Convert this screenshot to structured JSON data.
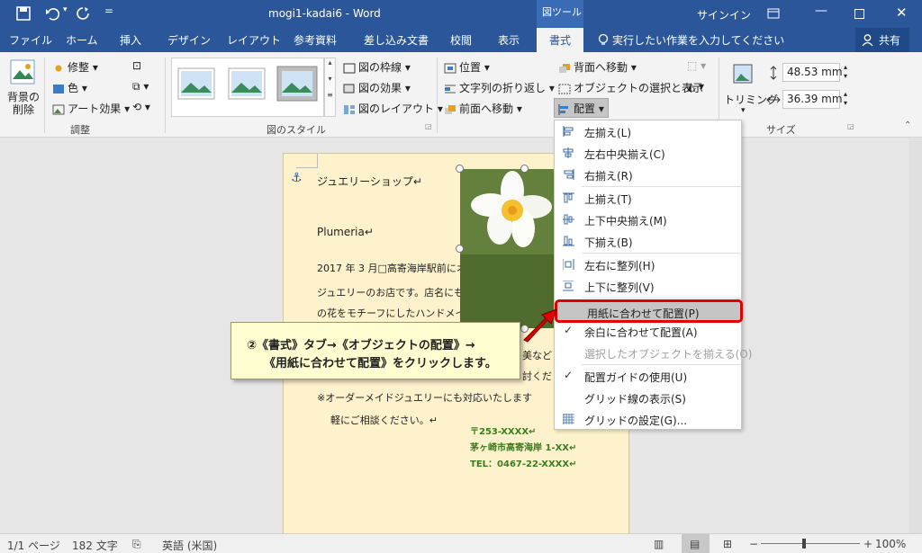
{
  "titlebar": {
    "doc_title": "mogi1-kadai6 - Word",
    "context_group": "図ツール",
    "signin": "サインイン"
  },
  "tabs": [
    "ファイル",
    "ホーム",
    "挿入",
    "デザイン",
    "レイアウト",
    "参考資料",
    "差し込み文書",
    "校閲",
    "表示",
    "書式"
  ],
  "tell_me": "実行したい作業を入力してください",
  "share": "共有",
  "ribbon": {
    "remove_bg": [
      "背景の",
      "削除"
    ],
    "adjust": {
      "corrections": "修整",
      "color": "色",
      "artistic": "アート効果",
      "label": "調整"
    },
    "styles": {
      "border": "図の枠線",
      "effects": "図の効果",
      "layout": "図のレイアウト",
      "label": "図のスタイル"
    },
    "arrange": {
      "position": "位置",
      "wrap": "文字列の折り返し",
      "forward": "前面へ移動",
      "backward": "背面へ移動",
      "selection": "オブジェクトの選択と表示",
      "align": "配置"
    },
    "size": {
      "crop": "トリミング",
      "height": "48.53 mm",
      "width": "36.39 mm",
      "label": "サイズ"
    }
  },
  "menu": {
    "items": [
      {
        "label": "左揃え(L)",
        "enabled": true,
        "checked": false
      },
      {
        "label": "左右中央揃え(C)",
        "enabled": true,
        "checked": false
      },
      {
        "label": "右揃え(R)",
        "enabled": true,
        "checked": false
      },
      {
        "label": "上揃え(T)",
        "enabled": true,
        "checked": false
      },
      {
        "label": "上下中央揃え(M)",
        "enabled": true,
        "checked": false
      },
      {
        "label": "下揃え(B)",
        "enabled": true,
        "checked": false
      },
      {
        "label": "左右に整列(H)",
        "enabled": true,
        "checked": false
      },
      {
        "label": "上下に整列(V)",
        "enabled": true,
        "checked": false
      },
      {
        "label": "用紙に合わせて配置(P)",
        "enabled": true,
        "checked": false,
        "highlighted": true
      },
      {
        "label": "余白に合わせて配置(A)",
        "enabled": true,
        "checked": true
      },
      {
        "label": "選択したオブジェクトを揃える(O)",
        "enabled": false,
        "checked": false
      },
      {
        "label": "配置ガイドの使用(U)",
        "enabled": true,
        "checked": true
      },
      {
        "label": "グリッド線の表示(S)",
        "enabled": true,
        "checked": false
      },
      {
        "label": "グリッドの設定(G)...",
        "enabled": true,
        "checked": false
      }
    ]
  },
  "document": {
    "heading": "ジュエリーショップ↵",
    "brand": "Plumeria↵",
    "line1": "2017 年 3 月□高寄海岸駅前にオープンしたハ",
    "line2": "ジュエリーのお店です。店名にもなってるプルメ",
    "line3": "の花をモチーフにしたハンドメイドのアクセサ",
    "line4": "美など",
    "line5": "討くだ",
    "line6": "※オーダーメイドジュエリーにも対応いたします",
    "line7": "軽にご相談ください。↵",
    "address": [
      "〒253-XXXX↵",
      "茅ヶ崎市高寄海岸 1-XX↵",
      "TEL：0467-22-XXXX↵"
    ]
  },
  "callout": {
    "line1": "②《書式》タブ→《オブジェクトの配置》→",
    "line2": "《用紙に合わせて配置》をクリックします。"
  },
  "status": {
    "page": "1/1 ページ",
    "words": "182 文字",
    "language": "英語 (米国)",
    "zoom": "100%"
  },
  "colors": {
    "titlebar": "#2b579a",
    "highlight_border": "#e00000",
    "page_bg": "#fef2cc"
  }
}
